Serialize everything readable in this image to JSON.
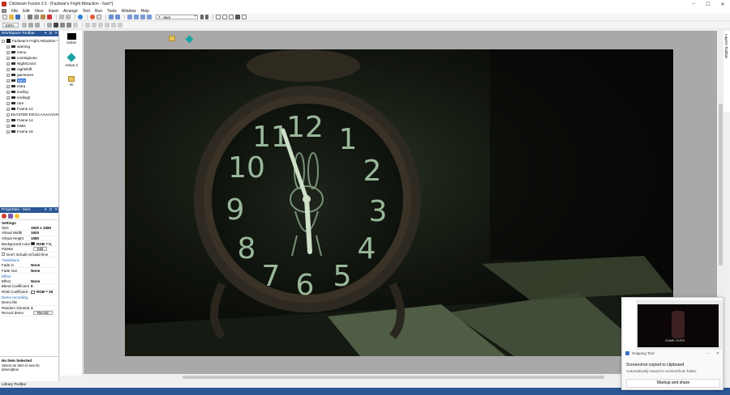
{
  "window": {
    "title": "Clickteam Fusion 2.5 - [Fazbear's Fright Attraction - 6am*]",
    "min": "–",
    "max": "☐",
    "close": "✕"
  },
  "menu": [
    "File",
    "Edit",
    "View",
    "Insert",
    "Arrange",
    "Text",
    "Run",
    "Tools",
    "Window",
    "Help"
  ],
  "toolbar": {
    "frame_select": "7 - 6am",
    "zoom": "100%"
  },
  "workspace": {
    "title": "Workspace Toolbar",
    "root": "Fazbear's Fright Attraction *",
    "frames": [
      "warning",
      "menu",
      "comingsoon",
      "NightCount",
      "nightshift",
      "gameover",
      "6am",
      "extra",
      "ending",
      "ending2",
      "rare",
      "Frame 12",
      "EASTER EGGA AAAAAGH",
      "Frame 14",
      "OMG",
      "Frame 16"
    ],
    "selected_index": 6
  },
  "properties": {
    "title": "Properties - 6am",
    "settings_label": "Settings",
    "rows": [
      {
        "key": "Size",
        "val": "1920 x 1080"
      },
      {
        "key": "Virtual Width",
        "val": "1920"
      },
      {
        "key": "Virtual Height",
        "val": "1080"
      }
    ],
    "bg_color_label": "Background color",
    "bg_color_value": "RGB = 0,",
    "palette_label": "Palette",
    "palette_button": "Edit",
    "dont_include_label": "Don't include at build time",
    "transitions_label": "Transitions",
    "fade_in_label": "Fade in",
    "fade_in_value": "None",
    "fade_out_label": "Fade Out",
    "fade_out_value": "None",
    "effect_link": "Effect",
    "effect_label": "Effect",
    "effect_value": "None",
    "blend_label": "Blend Coefficient",
    "blend_value": "0",
    "rgb_coef_label": "RGB Coefficient",
    "rgb_coef_value": "RGB = 25",
    "demo_link": "Demo recording",
    "demo_file_label": "Demo file",
    "random_label": "Random Generat",
    "random_value": "1",
    "record_label": "Record demo",
    "record_button": "Record"
  },
  "no_item": {
    "title": "No Item Selected",
    "desc": "Select an item to see its description"
  },
  "library_toolbar": "Library Toolbar",
  "layers_tab": "Layers Toolbar",
  "shelf": {
    "active": "Active",
    "active2": "Active 2",
    "ini": "Ini"
  },
  "scene": {
    "numerals": [
      "12",
      "1",
      "2",
      "3",
      "4",
      "5",
      "6",
      "7",
      "8",
      "9",
      "10",
      "11"
    ]
  },
  "snipping": {
    "app": "Snipping Tool",
    "title": "Screenshot copied to clipboard",
    "subtitle": "Automatically saved to screenshots folder.",
    "button": "Markup and share",
    "more": "···",
    "close": "✕",
    "preview_text": "GAME OVER"
  },
  "colors": {
    "accent": "#2b5797",
    "canvas_bg": "#0c0e09",
    "clock_glow": "#9ab89a"
  }
}
